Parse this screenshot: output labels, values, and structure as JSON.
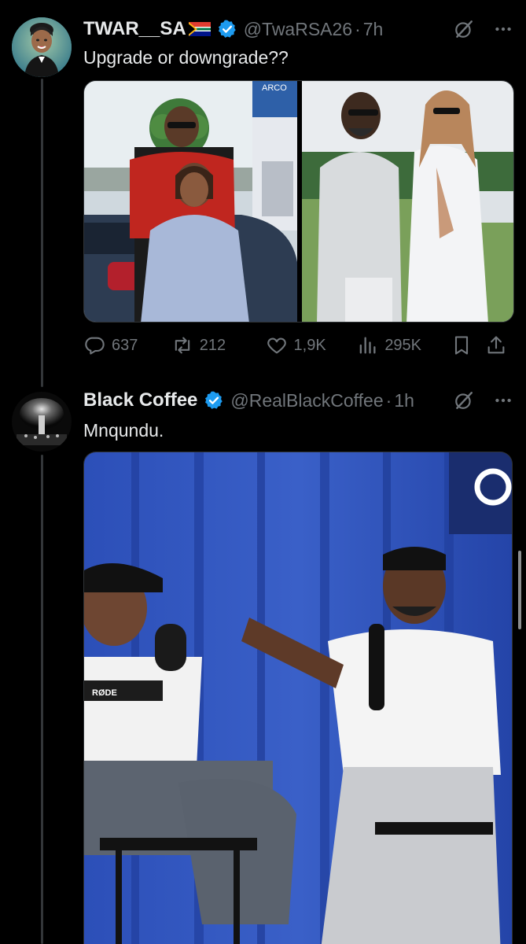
{
  "tweets": [
    {
      "display_name": "TWAR__SA",
      "handle": "@TwaRSA26",
      "separator": "·",
      "time": "7h",
      "text": "Upgrade or downgrade??",
      "media_label": "ARCO",
      "stats": {
        "replies": "637",
        "reposts": "212",
        "likes": "1,9K",
        "views": "295K"
      }
    },
    {
      "display_name": "Black Coffee",
      "handle": "@RealBlackCoffee",
      "separator": "·",
      "time": "1h",
      "text": "Mnqundu.",
      "media_label": "RØDE"
    }
  ],
  "colors": {
    "background": "#000000",
    "text_primary": "#e7e9ea",
    "text_secondary": "#71767b",
    "verified": "#1d9bf0"
  },
  "icons": [
    "flag-icon",
    "verified-icon",
    "grok-icon",
    "more-icon",
    "reply-icon",
    "repost-icon",
    "like-icon",
    "views-icon",
    "bookmark-icon",
    "share-icon"
  ]
}
